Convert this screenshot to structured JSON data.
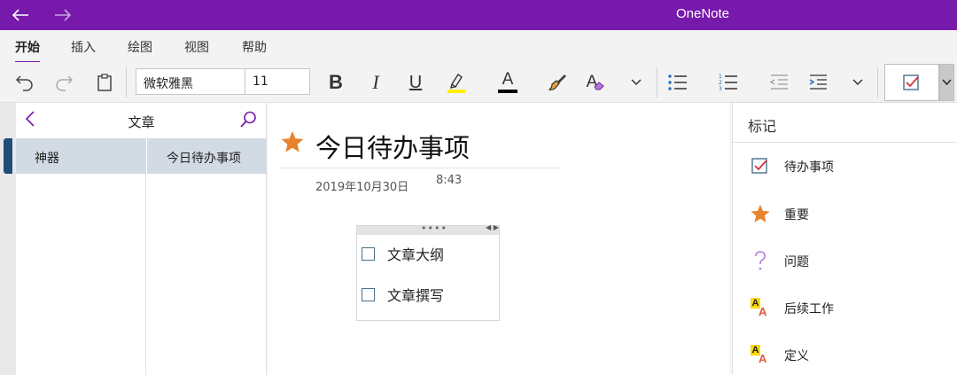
{
  "window": {
    "title": "OneNote",
    "back_icon": "arrow-left-icon",
    "forward_icon": "arrow-right-icon"
  },
  "ribbon": {
    "tabs": [
      {
        "label": "开始",
        "active": true
      },
      {
        "label": "插入"
      },
      {
        "label": "绘图"
      },
      {
        "label": "视图"
      },
      {
        "label": "帮助"
      }
    ]
  },
  "toolbar": {
    "font_name": "微软雅黑",
    "font_size": "11",
    "bold_label": "B",
    "italic_label": "I",
    "underline_label": "U",
    "font_color_label": "A",
    "clear_format_label": "A",
    "highlight_color": "#ffee00",
    "font_color": "#000000"
  },
  "notebook": {
    "title": "文章",
    "section": "神器",
    "page": "今日待办事项"
  },
  "page": {
    "title": "今日待办事项",
    "date": "2019年10月30日",
    "time": "8:43",
    "note_handle": "••••",
    "note_arrows": "◀ ▶",
    "todos": [
      "文章大纲",
      "文章撰写"
    ]
  },
  "tags_pane": {
    "title": "标记",
    "items": [
      {
        "label": "待办事项",
        "icon": "checkbox-checked-icon"
      },
      {
        "label": "重要",
        "icon": "star-icon"
      },
      {
        "label": "问题",
        "icon": "question-icon"
      },
      {
        "label": "后续工作",
        "icon": "highlight-aa-icon",
        "glyphs": [
          "A",
          "A"
        ]
      },
      {
        "label": "定义",
        "icon": "highlight-aa-icon",
        "glyphs": [
          "A",
          "A"
        ]
      }
    ]
  },
  "colors": {
    "accent": "#7719aa",
    "selection": "#d2dbe4",
    "star": "#e8822e",
    "question": "#b07fd0"
  }
}
